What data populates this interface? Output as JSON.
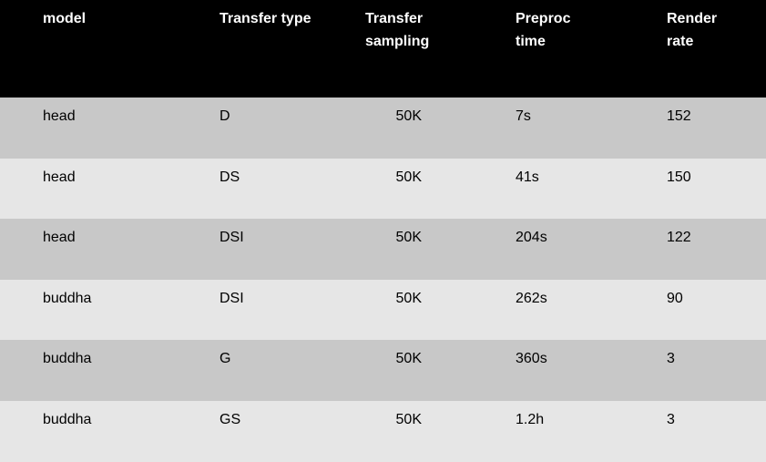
{
  "headers": {
    "model": "model",
    "transfer_type": "Transfer type",
    "transfer_sampling_1": "Transfer",
    "transfer_sampling_2": "sampling",
    "preproc_time_1": "Preproc",
    "preproc_time_2": "time",
    "render_rate_1": "Render",
    "render_rate_2": "rate"
  },
  "rows": [
    {
      "model": "head",
      "type": "D",
      "sampling": "50K",
      "preproc": "7s",
      "rate": "152"
    },
    {
      "model": "head",
      "type": "DS",
      "sampling": "50K",
      "preproc": "41s",
      "rate": "150"
    },
    {
      "model": "head",
      "type": "DSI",
      "sampling": "50K",
      "preproc": "204s",
      "rate": "122"
    },
    {
      "model": "buddha",
      "type": "DSI",
      "sampling": "50K",
      "preproc": "262s",
      "rate": "90"
    },
    {
      "model": "buddha",
      "type": "G",
      "sampling": "50K",
      "preproc": "360s",
      "rate": "3"
    },
    {
      "model": "buddha",
      "type": "GS",
      "sampling": "50K",
      "preproc": "1.2h",
      "rate": "3"
    }
  ],
  "colors": {
    "header_bg": "#000000",
    "row_odd_bg": "#c8c8c8",
    "row_even_bg": "#e6e6e6"
  }
}
